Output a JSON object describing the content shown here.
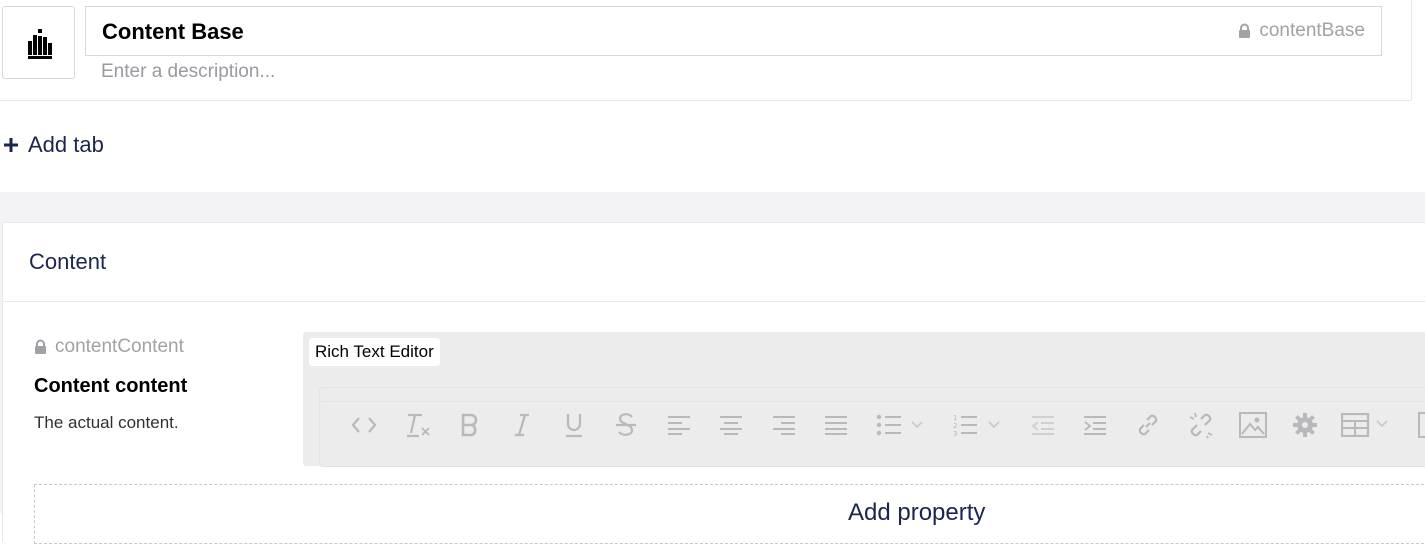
{
  "header": {
    "name": "Content Base",
    "alias": "contentBase",
    "description_placeholder": "Enter a description..."
  },
  "add_tab_label": "Add tab",
  "group": {
    "title": "Content",
    "property": {
      "alias": "contentContent",
      "name": "Content content",
      "description": "The actual content.",
      "editor_label": "Rich Text Editor"
    }
  },
  "add_content_label": "Add property",
  "toolbar_icons": [
    "code-icon",
    "remove-format-icon",
    "bold-icon",
    "italic-icon",
    "underline-icon",
    "strikethrough-icon",
    "align-left-icon",
    "align-center-icon",
    "align-right-icon",
    "align-justify-icon",
    "bullet-list-icon",
    "numbered-list-icon",
    "outdent-icon",
    "indent-icon",
    "link-icon",
    "unlink-icon",
    "image-icon",
    "settings-icon",
    "table-icon"
  ]
}
